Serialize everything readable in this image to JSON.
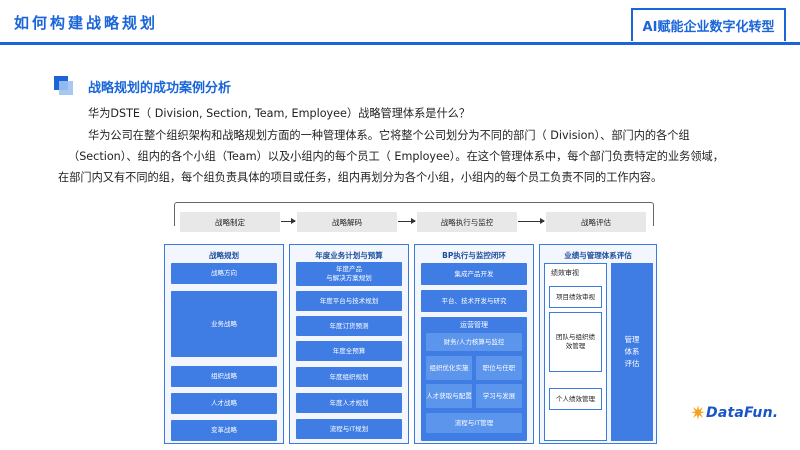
{
  "header": {
    "title": "如何构建战略规划",
    "badge": "AI赋能企业数字化转型"
  },
  "section": {
    "title": "战略规划的成功案例分析"
  },
  "paragraph": {
    "line1": "华为DSTE（ Division, Section, Team, Employee）战略管理体系是什么？",
    "line2": "华为公司在整个组织架构和战略规划方面的一种管理体系。它将整个公司划分为不同的部门（ Division）、部门内的各个组",
    "line3": "（Section）、组内的各个小组（Team）以及小组内的每个员工（ Employee）。在这个管理体系中，每个部门负责特定的业务领域，",
    "line4": "在部门内又有不同的组，每个组负责具体的项目或任务，组内再划分为各个小组，小组内的每个员工负责不同的工作内容。"
  },
  "diagram": {
    "stages": [
      "战略制定",
      "战略解码",
      "战略执行与监控",
      "战略评估"
    ],
    "columns": {
      "strategy": {
        "title": "战略规划",
        "items": [
          "战略方向",
          "业务战略",
          "组织战略",
          "人才战略",
          "变革战略"
        ]
      },
      "annual": {
        "title": "年度业务计划与预算",
        "items": [
          "年度产品\n与解决方案规划",
          "年度平台与技术规划",
          "年度订货预测",
          "年度全预算",
          "年度组织规划",
          "年度人才规划",
          "流程与IT规划"
        ]
      },
      "bp": {
        "title": "BP执行与监控闭环",
        "items": [
          "集成产品开发",
          "平台、技术开发与研究"
        ],
        "ops_title": "运营管理",
        "ops_items": [
          "财务/人力核算与监控",
          "组织优化实施",
          "职位与任职",
          "人才获取与配置",
          "学习与发展",
          "流程与IT管理"
        ]
      },
      "eval": {
        "title": "业绩与管理体系评估",
        "perf_title": "绩效审视",
        "perf_items": [
          "项目绩效审视",
          "团队与组织绩效管理",
          "个人绩效管理"
        ],
        "mgmt": "管理\n体系\n评估"
      }
    }
  },
  "logo": {
    "text": "DataFun."
  },
  "colors": {
    "primary": "#1a66d8",
    "cell": "#3f7ce4",
    "panel_bg": "#f3f7fd"
  }
}
